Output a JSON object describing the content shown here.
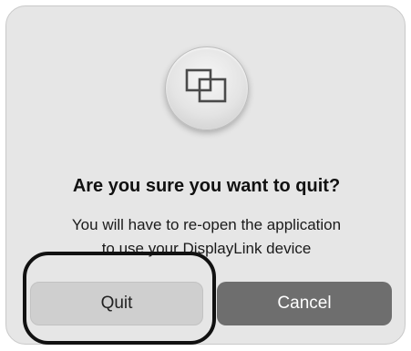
{
  "dialog": {
    "app_icon": "displaylink-screens-icon",
    "title": "Are you sure you want to quit?",
    "message_lines": [
      "You will have to re-open the application",
      "to use your DisplayLink device"
    ],
    "buttons": {
      "quit_label": "Quit",
      "cancel_label": "Cancel"
    }
  },
  "colors": {
    "dialog_background": "#e6e6e6",
    "quit_button": "#cfcfcf",
    "cancel_button": "#6e6e6e",
    "highlight_ring": "#111111"
  }
}
